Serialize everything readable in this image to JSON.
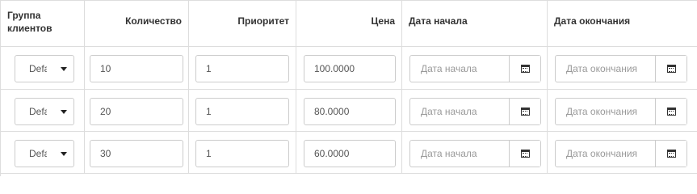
{
  "headers": {
    "group": "Группа клиентов",
    "quantity": "Количество",
    "priority": "Приоритет",
    "price": "Цена",
    "date_start": "Дата начала",
    "date_end": "Дата окончания"
  },
  "rows": [
    {
      "group": "Default",
      "quantity": "10",
      "priority": "1",
      "price": "100.0000",
      "date_start_placeholder": "Дата начала",
      "date_end_placeholder": "Дата окончания"
    },
    {
      "group": "Default",
      "quantity": "20",
      "priority": "1",
      "price": "80.0000",
      "date_start_placeholder": "Дата начала",
      "date_end_placeholder": "Дата окончания"
    },
    {
      "group": "Default",
      "quantity": "30",
      "priority": "1",
      "price": "60.0000",
      "date_start_placeholder": "Дата начала",
      "date_end_placeholder": "Дата окончания"
    }
  ],
  "icons": {
    "date_button": "calendar-icon",
    "select_arrow": "caret-down-icon"
  }
}
